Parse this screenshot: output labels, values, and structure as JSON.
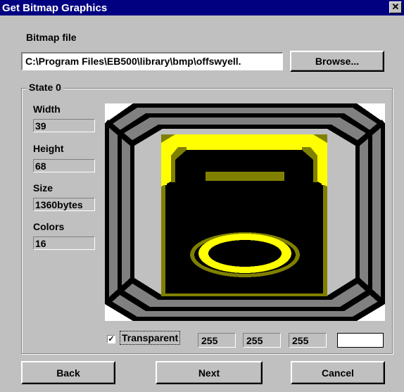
{
  "window": {
    "title": "Get Bitmap Graphics",
    "close_glyph": "✕"
  },
  "file": {
    "label": "Bitmap file",
    "path": "C:\\Program Files\\EB500\\library\\bmp\\offswyell.",
    "browse_label": "Browse..."
  },
  "state": {
    "label": "State 0",
    "width_label": "Width",
    "width_value": "39",
    "height_label": "Height",
    "height_value": "68",
    "size_label": "Size",
    "size_value": "1360bytes",
    "colors_label": "Colors",
    "colors_value": "16"
  },
  "transparent": {
    "checked": true,
    "check_glyph": "✓",
    "label": "Transparent",
    "r": "255",
    "g": "255",
    "b": "255",
    "swatch_color": "#ffffff"
  },
  "preview": {
    "image": "yellow-switch-bitmap",
    "colors": {
      "black": "#000000",
      "gray": "#808080",
      "silver": "#c0c0c0",
      "yellow": "#ffff00",
      "olive": "#808000",
      "white": "#ffffff"
    }
  },
  "buttons": {
    "back": "Back",
    "next": "Next",
    "cancel": "Cancel"
  }
}
